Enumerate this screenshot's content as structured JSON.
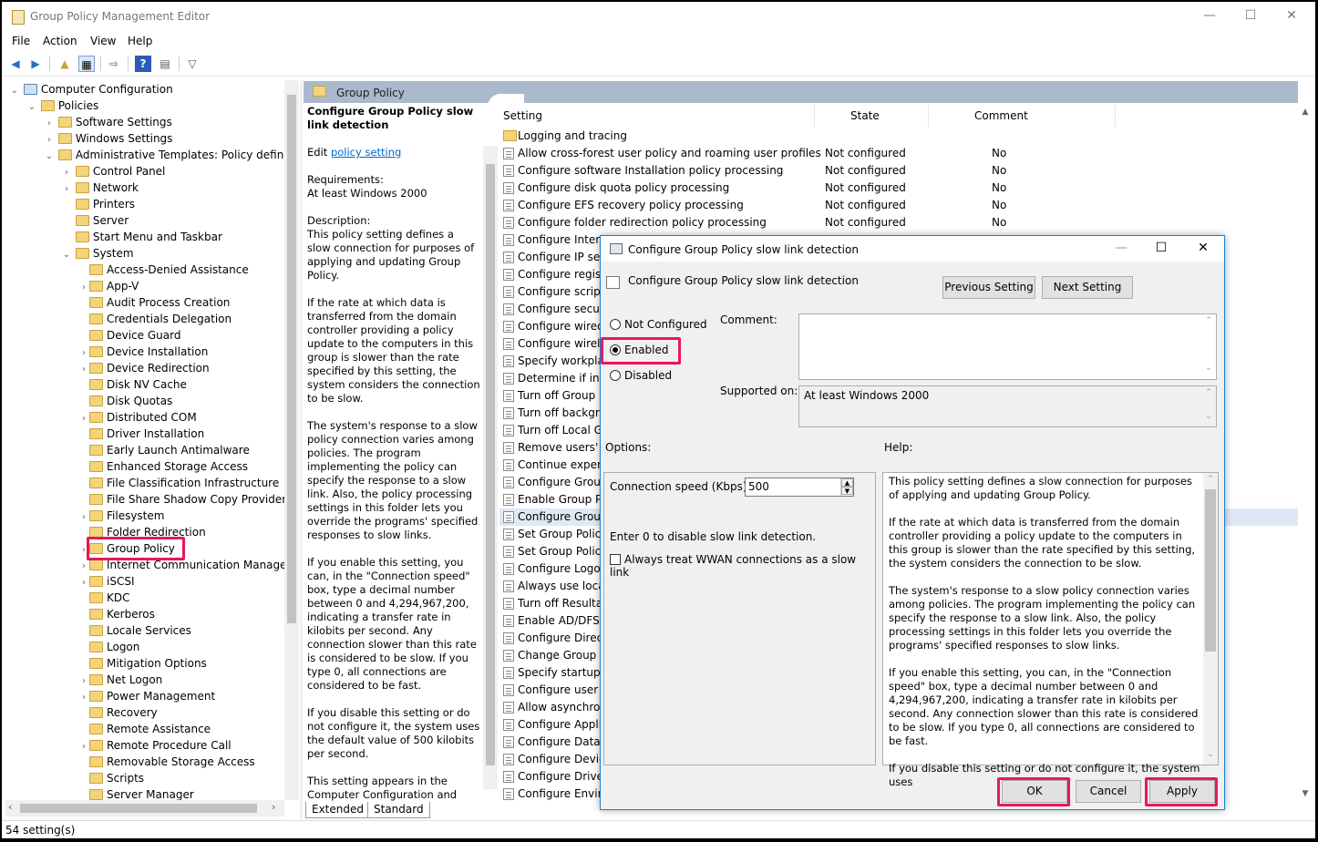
{
  "window": {
    "title": "Group Policy Management Editor",
    "minimize": "—",
    "maximize": "☐",
    "close": "✕"
  },
  "menu": [
    "File",
    "Action",
    "View",
    "Help"
  ],
  "tree": {
    "root": "Computer Configuration",
    "policies": "Policies",
    "software_settings": "Software Settings",
    "windows_settings": "Windows Settings",
    "admin_templates": "Administrative Templates: Policy definitions",
    "l1": [
      "Control Panel",
      "Network",
      "Printers",
      "Server",
      "Start Menu and Taskbar",
      "System"
    ],
    "system_children": [
      "Access-Denied Assistance",
      "App-V",
      "Audit Process Creation",
      "Credentials Delegation",
      "Device Guard",
      "Device Installation",
      "Device Redirection",
      "Disk NV Cache",
      "Disk Quotas",
      "Distributed COM",
      "Driver Installation",
      "Early Launch Antimalware",
      "Enhanced Storage Access",
      "File Classification Infrastructure",
      "File Share Shadow Copy Provider",
      "Filesystem",
      "Folder Redirection",
      "Group Policy",
      "Internet Communication Management",
      "iSCSI",
      "KDC",
      "Kerberos",
      "Locale Services",
      "Logon",
      "Mitigation Options",
      "Net Logon",
      "Power Management",
      "Recovery",
      "Remote Assistance",
      "Remote Procedure Call",
      "Removable Storage Access",
      "Scripts",
      "Server Manager"
    ],
    "selected": "Group Policy"
  },
  "right_header": "Group Policy",
  "description": {
    "title": "Configure Group Policy slow link detection",
    "edit_prefix": "Edit ",
    "edit_link": "policy setting",
    "requirements_label": "Requirements:",
    "requirements": "At least Windows 2000",
    "description_label": "Description:",
    "paras": [
      "This policy setting defines a slow connection for purposes of applying and updating Group Policy.",
      "If the rate at which data is transferred from the domain controller providing a policy update to the computers in this group is slower than the rate specified by this setting, the system considers the connection to be slow.",
      "The system's response to a slow policy connection varies among policies. The program implementing the policy can specify the response to a slow link. Also, the policy processing settings in this folder lets you override the programs' specified responses to slow links.",
      "If you enable this setting, you can, in the \"Connection speed\" box, type a decimal number between 0 and 4,294,967,200, indicating a transfer rate in kilobits per second. Any connection slower than this rate is considered to be slow. If you type 0, all connections are considered to be fast.",
      "If you disable this setting or do not configure it, the system uses the default value of 500 kilobits per second.",
      "This setting appears in the Computer Configuration and User Configuration folders. The setting"
    ]
  },
  "list": {
    "headers": {
      "setting": "Setting",
      "state": "State",
      "comment": "Comment"
    },
    "folder_row": "Logging and tracing",
    "rows": [
      {
        "name": "Allow cross-forest user policy and roaming user profiles",
        "state": "Not configured",
        "comment": "No"
      },
      {
        "name": "Configure software Installation policy processing",
        "state": "Not configured",
        "comment": "No"
      },
      {
        "name": "Configure disk quota policy processing",
        "state": "Not configured",
        "comment": "No"
      },
      {
        "name": "Configure EFS recovery policy processing",
        "state": "Not configured",
        "comment": "No"
      },
      {
        "name": "Configure folder redirection policy processing",
        "state": "Not configured",
        "comment": "No"
      },
      {
        "name": "Configure Interne",
        "state": "",
        "comment": ""
      },
      {
        "name": "Configure IP secu",
        "state": "",
        "comment": ""
      },
      {
        "name": "Configure registr",
        "state": "",
        "comment": ""
      },
      {
        "name": "Configure scripts",
        "state": "",
        "comment": ""
      },
      {
        "name": "Configure securit",
        "state": "",
        "comment": ""
      },
      {
        "name": "Configure wired p",
        "state": "",
        "comment": ""
      },
      {
        "name": "Configure wireles",
        "state": "",
        "comment": ""
      },
      {
        "name": "Specify workplac",
        "state": "",
        "comment": ""
      },
      {
        "name": "Determine if inter",
        "state": "",
        "comment": ""
      },
      {
        "name": "Turn off Group P",
        "state": "",
        "comment": ""
      },
      {
        "name": "Turn off backgro",
        "state": "",
        "comment": ""
      },
      {
        "name": "Turn off Local Gr",
        "state": "",
        "comment": ""
      },
      {
        "name": "Remove users' ab",
        "state": "",
        "comment": ""
      },
      {
        "name": "Continue experie",
        "state": "",
        "comment": ""
      },
      {
        "name": "Configure Group",
        "state": "",
        "comment": ""
      },
      {
        "name": "Enable Group Pol",
        "state": "",
        "comment": ""
      },
      {
        "name": "Configure Group",
        "state": "",
        "comment": ""
      },
      {
        "name": "Set Group Policy",
        "state": "",
        "comment": ""
      },
      {
        "name": "Set Group Policy",
        "state": "",
        "comment": ""
      },
      {
        "name": "Configure Logon",
        "state": "",
        "comment": ""
      },
      {
        "name": "Always use local",
        "state": "",
        "comment": ""
      },
      {
        "name": "Turn off Resultan",
        "state": "",
        "comment": ""
      },
      {
        "name": "Enable AD/DFS d",
        "state": "",
        "comment": ""
      },
      {
        "name": "Configure Direct",
        "state": "",
        "comment": ""
      },
      {
        "name": "Change Group Po",
        "state": "",
        "comment": ""
      },
      {
        "name": "Specify startup p",
        "state": "",
        "comment": ""
      },
      {
        "name": "Configure user G",
        "state": "",
        "comment": ""
      },
      {
        "name": "Allow asynchrone",
        "state": "",
        "comment": ""
      },
      {
        "name": "Configure Applic",
        "state": "",
        "comment": ""
      },
      {
        "name": "Configure Data S",
        "state": "",
        "comment": ""
      },
      {
        "name": "Configure Device",
        "state": "",
        "comment": ""
      },
      {
        "name": "Configure Drive M",
        "state": "",
        "comment": ""
      },
      {
        "name": "Configure Enviro",
        "state": "",
        "comment": ""
      }
    ],
    "selected_index": 21
  },
  "tabs": {
    "extended": "Extended",
    "standard": "Standard"
  },
  "status": "54 setting(s)",
  "dialog": {
    "title": "Configure Group Policy slow link detection",
    "subtitle": "Configure Group Policy slow link detection",
    "prev_button": "Previous Setting",
    "next_button": "Next Setting",
    "radio_not_configured": "Not Configured",
    "radio_enabled": "Enabled",
    "radio_disabled": "Disabled",
    "selected_radio": "Enabled",
    "comment_label": "Comment:",
    "comment_value": "",
    "supported_label": "Supported on:",
    "supported_value": "At least Windows 2000",
    "options_label": "Options:",
    "help_label": "Help:",
    "connection_speed_label": "Connection speed (Kbps):",
    "connection_speed_value": "500",
    "zero_hint": "Enter 0 to disable slow link detection.",
    "wwan_label": "Always treat WWAN connections as a slow link",
    "wwan_checked": false,
    "help_paras": [
      "This policy setting defines a slow connection for purposes of applying and updating Group Policy.",
      "If the rate at which data is transferred from the domain controller providing a policy update to the computers in this group is slower than the rate specified by this setting, the system considers the connection to be slow.",
      "The system's response to a slow policy connection varies among policies. The program implementing the policy can specify the response to a slow link. Also, the policy processing settings in this folder lets you override the programs' specified responses to slow links.",
      "If you enable this setting, you can, in the \"Connection speed\" box, type a decimal number between 0 and 4,294,967,200, indicating a transfer rate in kilobits per second. Any connection slower than this rate is considered to be slow. If you type 0, all connections are considered to be fast.",
      "If you disable this setting or do not configure it, the system uses"
    ],
    "ok_button": "OK",
    "cancel_button": "Cancel",
    "apply_button": "Apply"
  },
  "colors": {
    "highlight": "#e8175d",
    "header_band": "#aab9cc",
    "link": "#0066cc",
    "dialog_border": "#1c7fd6"
  }
}
